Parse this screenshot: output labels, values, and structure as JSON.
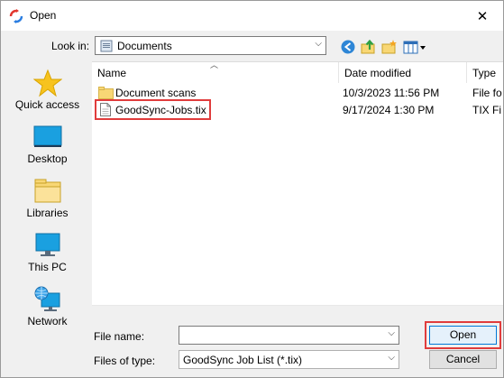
{
  "window": {
    "title": "Open",
    "close_glyph": "✕"
  },
  "lookin": {
    "label": "Look in:",
    "value": "Documents"
  },
  "toolbar": [
    "back-icon",
    "up-folder-icon",
    "new-folder-icon",
    "view-menu-icon"
  ],
  "places": [
    {
      "label": "Quick access",
      "icon": "star-icon"
    },
    {
      "label": "Desktop",
      "icon": "desktop-icon"
    },
    {
      "label": "Libraries",
      "icon": "libraries-icon"
    },
    {
      "label": "This PC",
      "icon": "this-pc-icon"
    },
    {
      "label": "Network",
      "icon": "network-icon"
    }
  ],
  "columns": {
    "name": "Name",
    "date": "Date modified",
    "type": "Type"
  },
  "files": [
    {
      "name": "Document scans",
      "date": "10/3/2023 11:56 PM",
      "type": "File fo",
      "kind": "folder"
    },
    {
      "name": "GoodSync-Jobs.tix",
      "date": "9/17/2024 1:30 PM",
      "type": "TIX Fi",
      "kind": "file"
    }
  ],
  "filename": {
    "label": "File name:",
    "value": ""
  },
  "filetype": {
    "label": "Files of type:",
    "value": "GoodSync Job List (*.tix)"
  },
  "buttons": {
    "open": "Open",
    "cancel": "Cancel"
  },
  "colors": {
    "highlight": "#e03c3c",
    "accent": "#0078d7",
    "folder": "#f8d775"
  }
}
